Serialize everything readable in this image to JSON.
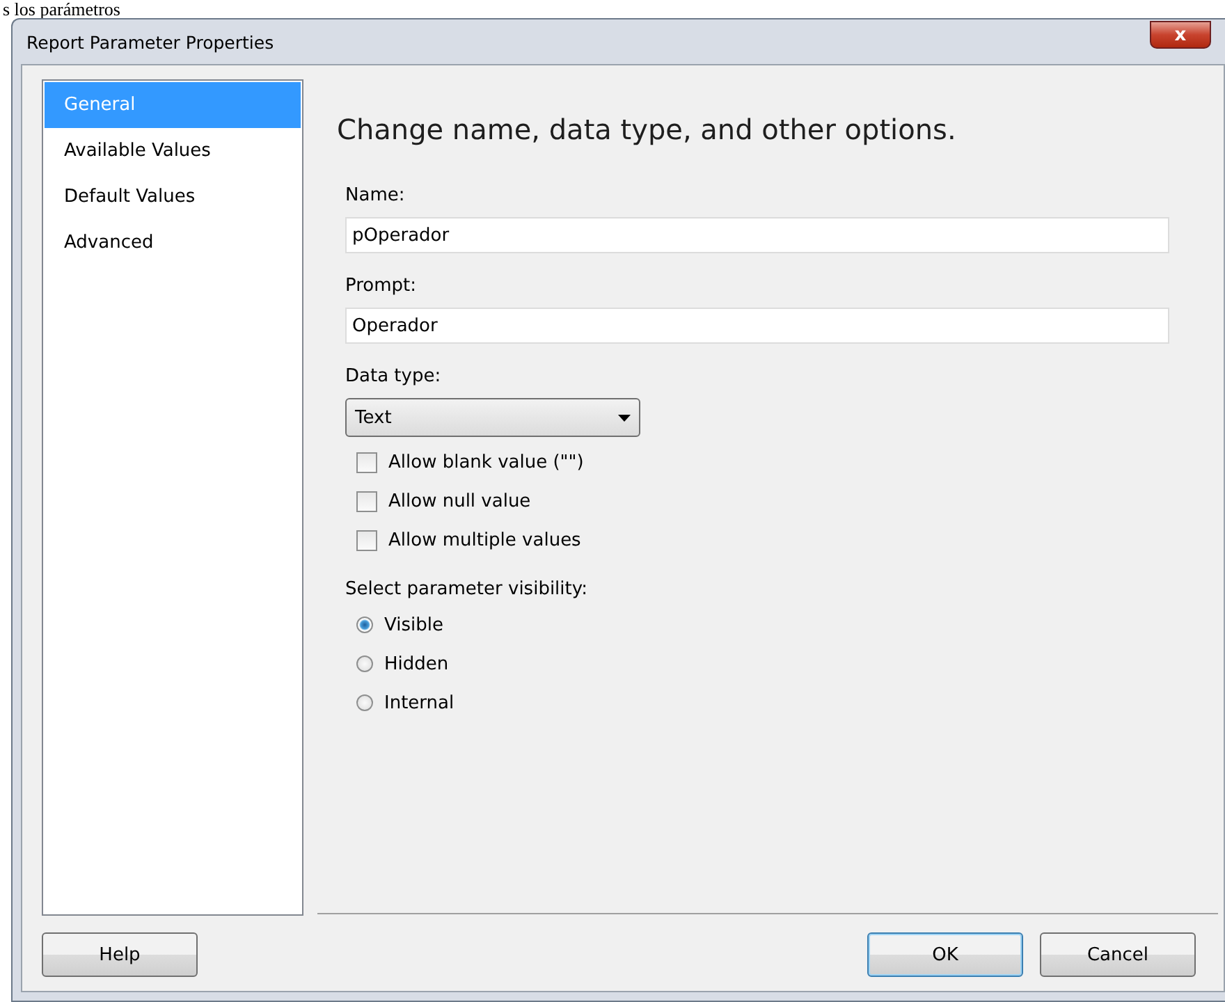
{
  "background_text": "s los parámetros",
  "window": {
    "title": "Report Parameter Properties",
    "close": "x"
  },
  "sidebar": {
    "items": [
      {
        "label": "General",
        "selected": true
      },
      {
        "label": "Available Values",
        "selected": false
      },
      {
        "label": "Default Values",
        "selected": false
      },
      {
        "label": "Advanced",
        "selected": false
      }
    ]
  },
  "heading": "Change name, data type, and other options.",
  "name_field": {
    "label": "Name:",
    "value": "pOperador"
  },
  "prompt_field": {
    "label": "Prompt:",
    "value": "Operador"
  },
  "data_type": {
    "label": "Data type:",
    "value": "Text"
  },
  "checkboxes": [
    {
      "label": "Allow blank value (\"\")",
      "checked": false
    },
    {
      "label": "Allow null value",
      "checked": false
    },
    {
      "label": "Allow multiple values",
      "checked": false
    }
  ],
  "visibility": {
    "label": "Select parameter visibility:",
    "options": [
      {
        "label": "Visible",
        "selected": true
      },
      {
        "label": "Hidden",
        "selected": false
      },
      {
        "label": "Internal",
        "selected": false
      }
    ]
  },
  "buttons": {
    "help": "Help",
    "ok": "OK",
    "cancel": "Cancel"
  }
}
